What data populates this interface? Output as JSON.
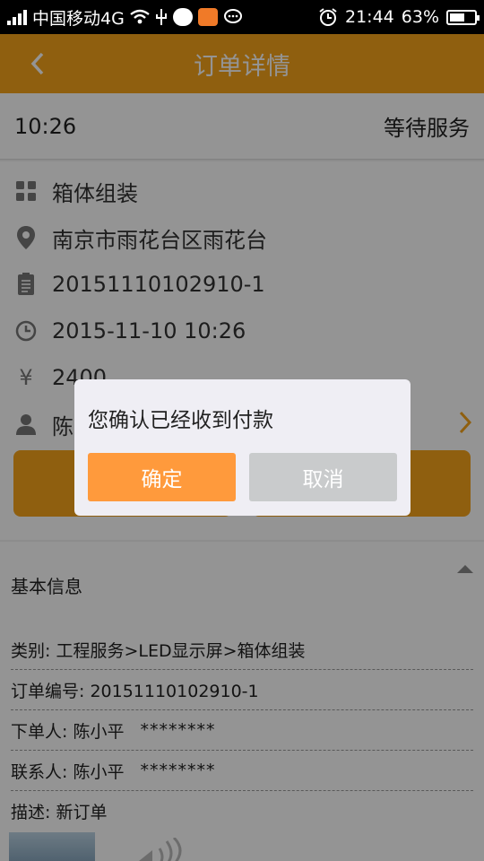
{
  "status_bar": {
    "carrier": "中国移动4G",
    "time": "21:44",
    "battery": "63%",
    "battery_level": 0.63
  },
  "header": {
    "back_icon": "chevron-left-icon",
    "title": "订单详情"
  },
  "order": {
    "time": "10:26",
    "status": "等待服务",
    "items": [
      {
        "icon": "grid-icon",
        "text": "箱体组装"
      },
      {
        "icon": "location-pin-icon",
        "text": "南京市雨花台区雨花台"
      },
      {
        "icon": "document-icon",
        "text": "20151110102910-1"
      },
      {
        "icon": "clock-icon",
        "text": "2015-11-10 10:26"
      },
      {
        "icon": "yen-icon",
        "text": "2400"
      },
      {
        "icon": "person-icon",
        "text": "陈"
      }
    ]
  },
  "basic_info": {
    "title": "基本信息",
    "rows": [
      {
        "text": "类别:  工程服务>LED显示屏>箱体组装"
      },
      {
        "text": "订单编号:  20151110102910-1"
      },
      {
        "text": "下单人:   陈小平",
        "stars": "********"
      },
      {
        "text": "联系人:  陈小平",
        "stars": "********"
      },
      {
        "text": "描述:  新订单"
      }
    ]
  },
  "dialog": {
    "message": "您确认已经收到付款",
    "confirm_label": "确定",
    "cancel_label": "取消"
  },
  "colors": {
    "accent": "#f7a41a",
    "confirm": "#ff9a3c",
    "cancel": "#c9cbcc"
  }
}
